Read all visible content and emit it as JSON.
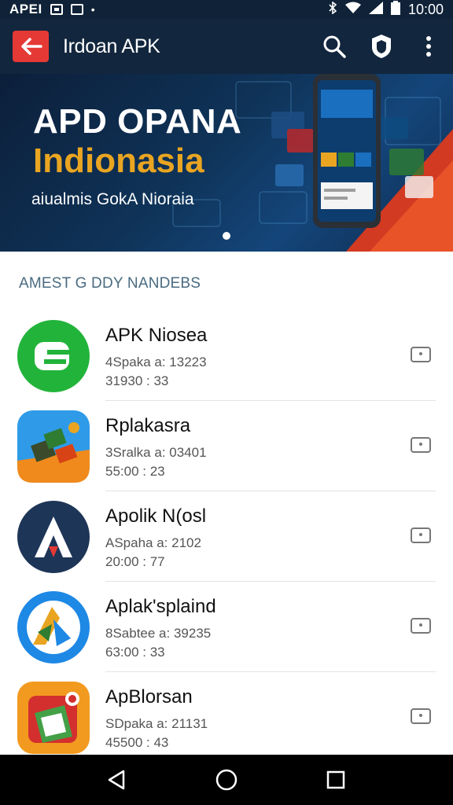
{
  "status_bar": {
    "carrier": "APEI",
    "time": "10:00"
  },
  "app_bar": {
    "title": "Irdoan APK"
  },
  "banner": {
    "title_line1": "APD OPANA",
    "title_line2": "Indionasia",
    "subtitle": "aiualmis GokA Nioraia"
  },
  "section_header": "AMEST G DDY NANDEBS",
  "apps": [
    {
      "name": "APK Niosea",
      "meta1": "4Spaka a: 13223",
      "meta2": "31930 : 33"
    },
    {
      "name": "Rplakasra",
      "meta1": "3Sralka a: 03401",
      "meta2": "55:00 : 23"
    },
    {
      "name": "Apolik N(osl",
      "meta1": "ASpaha a: 2102",
      "meta2": "20:00 : 77"
    },
    {
      "name": "Aplak'splaind",
      "meta1": "8Sabtee a: 39235",
      "meta2": "63:00 : 33"
    },
    {
      "name": "ApBlorsan",
      "meta1": "SDpaka a: 21131",
      "meta2": "45500 : 43"
    }
  ],
  "colors": {
    "appbar": "#12263d",
    "accent_red": "#e53935",
    "banner_gold": "#e9a521"
  }
}
